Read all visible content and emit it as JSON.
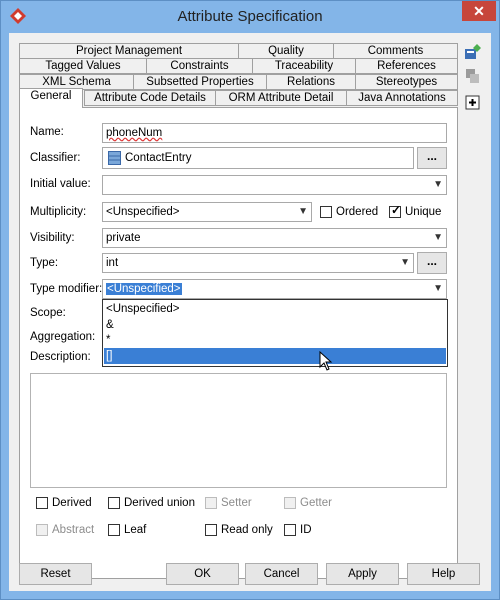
{
  "window": {
    "title": "Attribute Specification",
    "close_glyph": "✕"
  },
  "tabs": {
    "row1": [
      "Project Management",
      "Quality",
      "Comments"
    ],
    "row2": [
      "Tagged Values",
      "Constraints",
      "Traceability",
      "References"
    ],
    "row3": [
      "XML Schema",
      "Subsetted Properties",
      "Relations",
      "Stereotypes"
    ],
    "row4": [
      "General",
      "Attribute Code Details",
      "ORM Attribute Detail",
      "Java Annotations"
    ],
    "active": "General"
  },
  "form": {
    "name_label": "Name:",
    "name_value": "phoneNum",
    "classifier_label": "Classifier:",
    "classifier_value": "ContactEntry",
    "initial_value_label": "Initial value:",
    "initial_value": "",
    "multiplicity_label": "Multiplicity:",
    "multiplicity_value": "<Unspecified>",
    "ordered_label": "Ordered",
    "unique_label": "Unique",
    "visibility_label": "Visibility:",
    "visibility_value": "private",
    "type_label": "Type:",
    "type_value": "int",
    "type_modifier_label": "Type modifier:",
    "type_modifier_value": "<Unspecified>",
    "scope_label": "Scope:",
    "aggregation_label": "Aggregation:",
    "description_label": "Description:",
    "dots": "..."
  },
  "dropdown_options": [
    "<Unspecified>",
    "&",
    "*",
    "[]"
  ],
  "checkboxes": {
    "derived": "Derived",
    "derived_union": "Derived union",
    "setter": "Setter",
    "getter": "Getter",
    "abstract": "Abstract",
    "leaf": "Leaf",
    "read_only": "Read only",
    "id": "ID"
  },
  "checks": {
    "ordered": false,
    "unique": true,
    "derived": false,
    "derived_union": false,
    "setter": false,
    "getter": false,
    "abstract": false,
    "leaf": false,
    "read_only": false,
    "id": false
  },
  "buttons": {
    "reset": "Reset",
    "ok": "OK",
    "cancel": "Cancel",
    "apply": "Apply",
    "help": "Help"
  },
  "icons": [
    "app-icon",
    "close-icon",
    "add-diagram-icon",
    "stack-icon",
    "expand-icon",
    "class-icon",
    "mouse-cursor-icon"
  ]
}
